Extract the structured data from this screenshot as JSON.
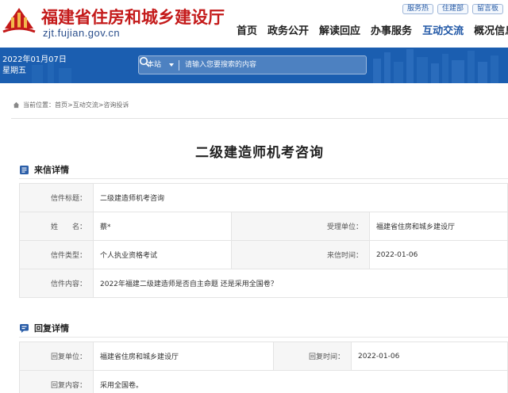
{
  "header": {
    "site_title": "福建省住房和城乡建设厅",
    "domain": "zjt.fujian.gov.cn",
    "top_links": [
      "服务热",
      "住建部",
      "留言板"
    ],
    "nav": [
      {
        "label": "首页",
        "active": false
      },
      {
        "label": "政务公开",
        "active": false
      },
      {
        "label": "解读回应",
        "active": false
      },
      {
        "label": "办事服务",
        "active": false
      },
      {
        "label": "互动交流",
        "active": true
      },
      {
        "label": "概况信息",
        "active": false
      }
    ]
  },
  "banner": {
    "date": "2022年01月07日",
    "weekday": "星期五",
    "search_scope": "本站",
    "search_placeholder": "请输入您要搜索的内容"
  },
  "breadcrumb": {
    "prefix": "当前位置：",
    "items": [
      "首页",
      "互动交流",
      "咨询投诉"
    ],
    "separator": " > "
  },
  "page_title": "二级建造师机考咨询",
  "letter": {
    "section_title": "来信详情",
    "subject_label": "信件标题：",
    "subject": "二级建造师机考咨询",
    "name_label": "姓　　名：",
    "name": "蔡*",
    "dept_label": "受理单位：",
    "dept": "福建省住房和城乡建设厅",
    "type_label": "信件类型：",
    "type": "个人执业资格考试",
    "date_label": "来信时间：",
    "date": "2022-01-06",
    "content_label": "信件内容：",
    "content": "2022年福建二级建造师是否自主命题 还是采用全国卷？"
  },
  "reply": {
    "section_title": "回复详情",
    "unit_label": "回复单位：",
    "unit": "福建省住房和城乡建设厅",
    "time_label": "回复时间：",
    "time": "2022-01-06",
    "content_label": "回复内容：",
    "content": "采用全国卷。"
  },
  "colors": {
    "brand_red": "#c41a1a",
    "banner_blue": "#1b5eb0",
    "nav_active": "#1f56a5",
    "section_icon": "#2b5ea8"
  }
}
